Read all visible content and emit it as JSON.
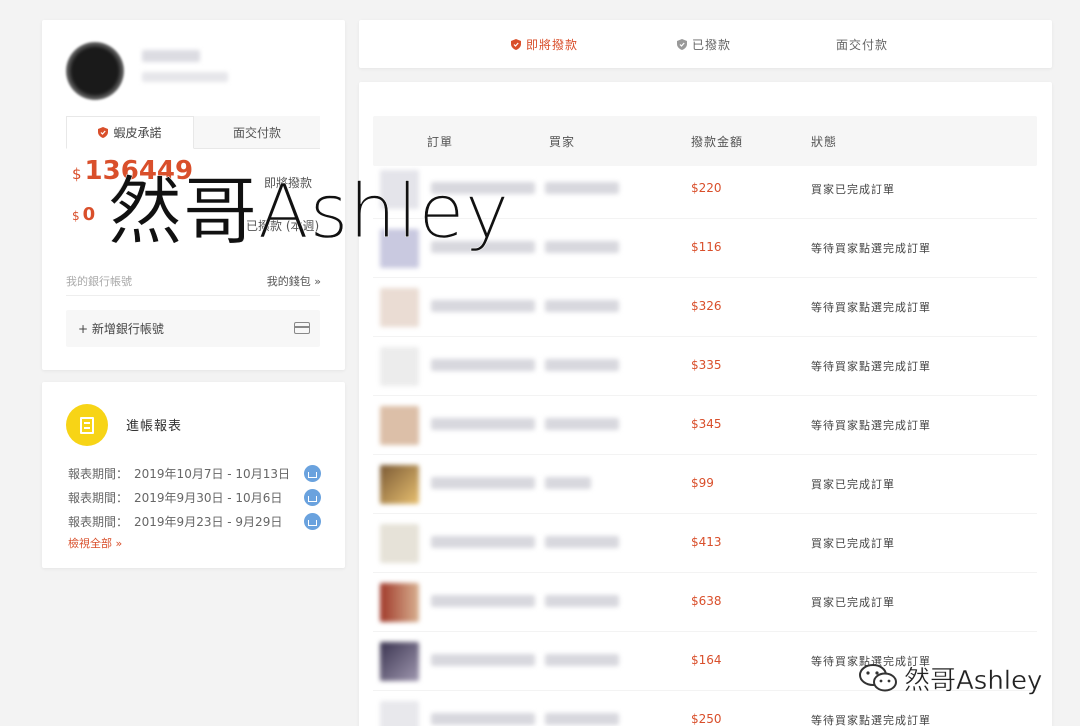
{
  "account": {
    "tabs": [
      "蝦皮承諾",
      "面交付款"
    ],
    "pending_amount": "136449",
    "pending_currency": "$",
    "pending_label": "即將撥款",
    "paid_amount": "0",
    "paid_currency": "$",
    "paid_label": "已撥款 (本週)",
    "bank_label": "我的銀行帳號",
    "wallet_link": "我的錢包 »",
    "add_bank": "+ 新增銀行帳號"
  },
  "report": {
    "title": "進帳報表",
    "rows": [
      {
        "label": "報表期間：",
        "period": "2019年10月7日 - 10月13日"
      },
      {
        "label": "報表期間：",
        "period": "2019年9月30日 - 10月6日"
      },
      {
        "label": "報表期間：",
        "period": "2019年9月23日 - 9月29日"
      }
    ],
    "view_all": "檢視全部 »"
  },
  "main_tabs": {
    "tabs": [
      {
        "label": "即將撥款",
        "active": true
      },
      {
        "label": "已撥款",
        "active": false
      },
      {
        "label": "面交付款",
        "active": false
      }
    ]
  },
  "orders": {
    "headers": [
      "訂單",
      "買家",
      "撥款金額",
      "狀態"
    ],
    "rows": [
      {
        "amount": "$220",
        "status": "買家已完成訂單"
      },
      {
        "amount": "$116",
        "status": "等待買家點選完成訂單"
      },
      {
        "amount": "$326",
        "status": "等待買家點選完成訂單"
      },
      {
        "amount": "$335",
        "status": "等待買家點選完成訂單"
      },
      {
        "amount": "$345",
        "status": "等待買家點選完成訂單"
      },
      {
        "amount": "$99",
        "status": "買家已完成訂單"
      },
      {
        "amount": "$413",
        "status": "買家已完成訂單"
      },
      {
        "amount": "$638",
        "status": "買家已完成訂單"
      },
      {
        "amount": "$164",
        "status": "等待買家點選完成訂單"
      },
      {
        "amount": "$250",
        "status": "等待買家點選完成訂單"
      }
    ]
  },
  "watermark": {
    "big": "然哥Ashley",
    "small": "然哥Ashley"
  },
  "colors": {
    "accent": "#d94f2b",
    "report_icon": "#f7d416",
    "download_icon": "#6aa2de"
  },
  "icons": [
    "shield-icon",
    "document-icon",
    "download-icon",
    "credit-card-icon",
    "wechat-logo-icon"
  ]
}
